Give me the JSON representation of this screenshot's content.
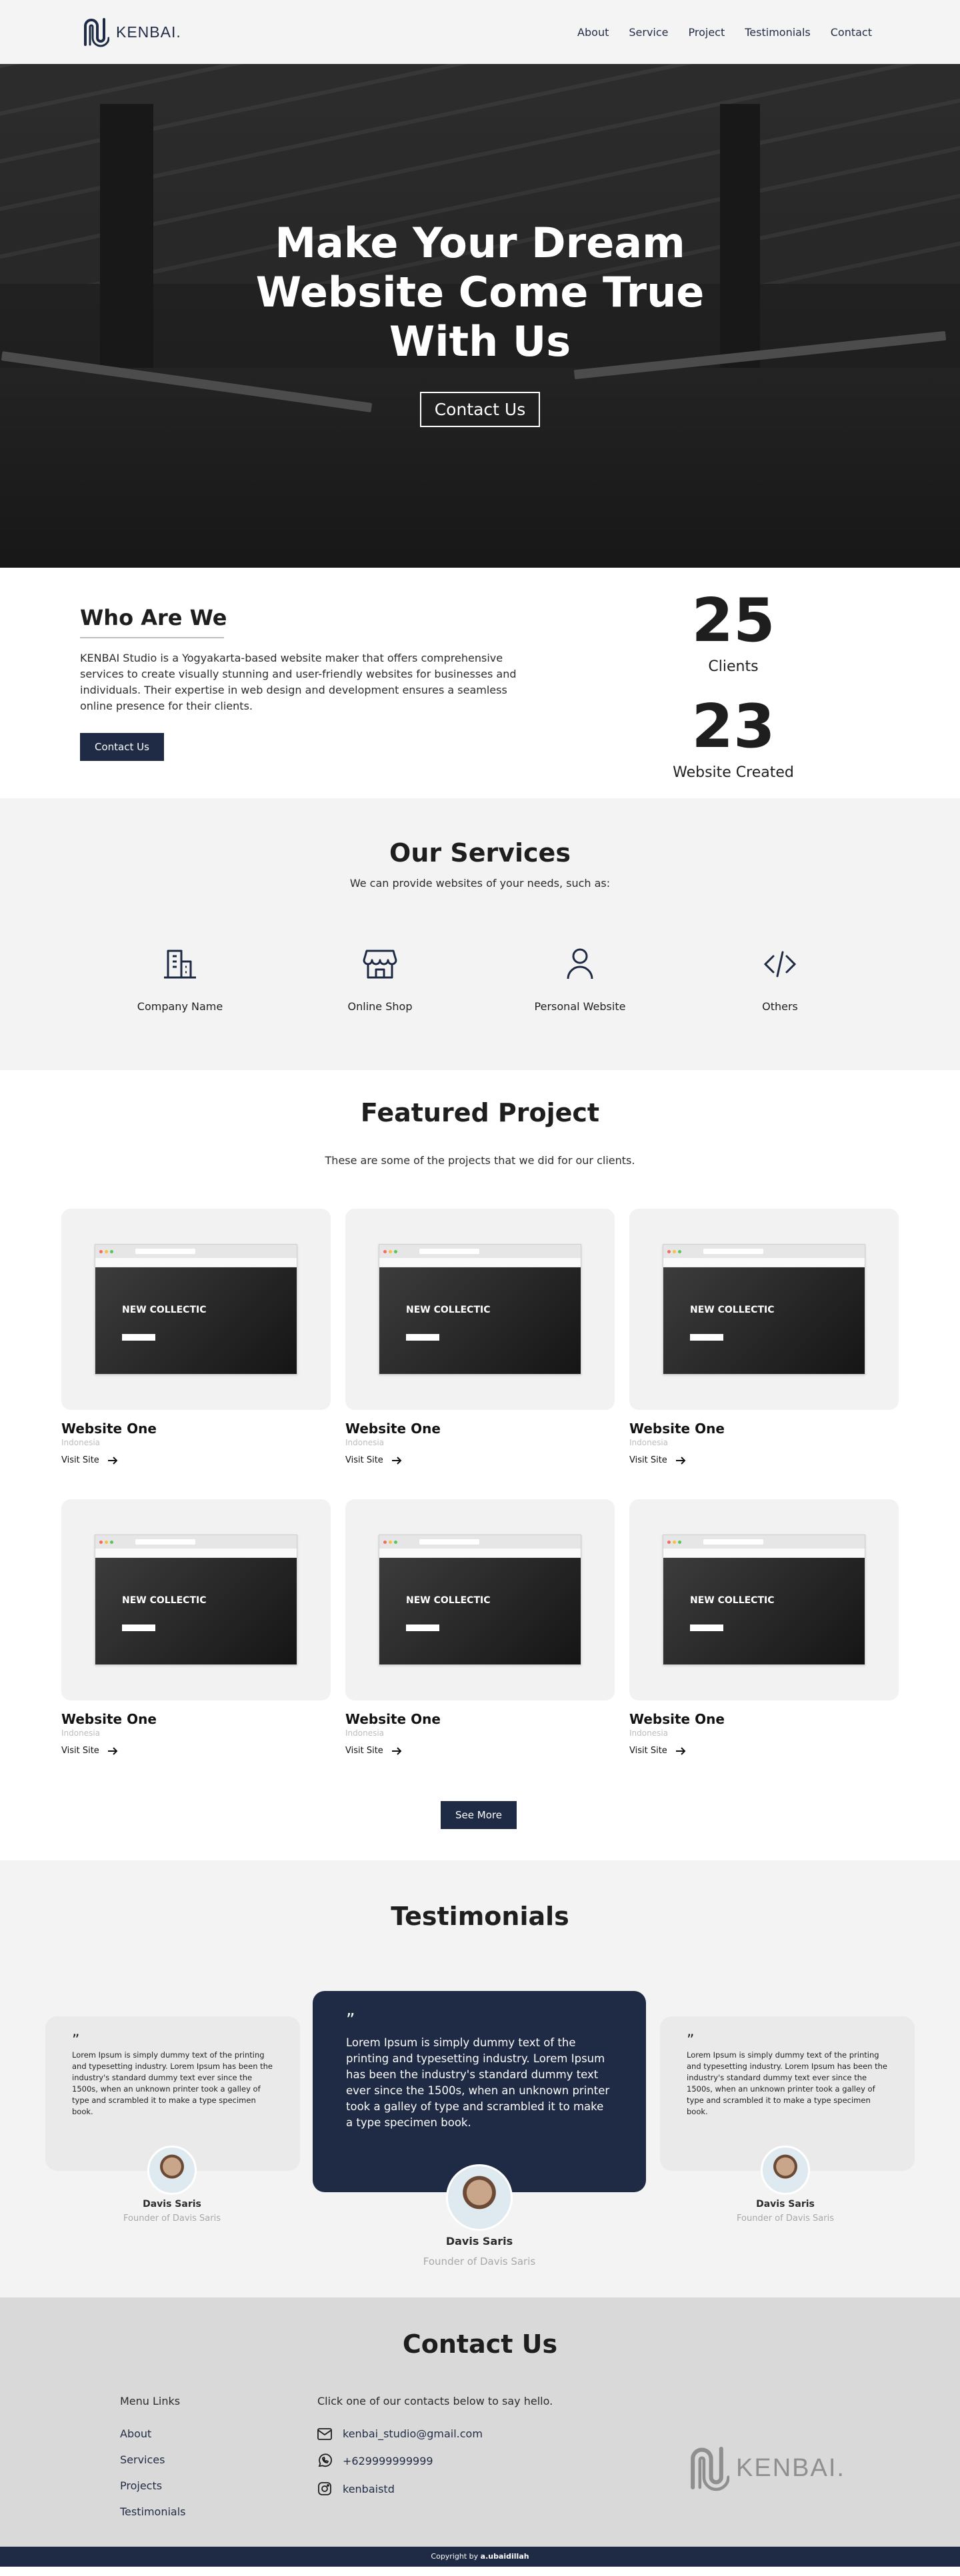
{
  "brand": {
    "name": "KENBAI."
  },
  "nav": {
    "links": [
      "About",
      "Service",
      "Project",
      "Testimonials",
      "Contact"
    ]
  },
  "hero": {
    "title": "Make Your Dream Website Come True With Us",
    "button": "Contact Us"
  },
  "about": {
    "title": "Who Are We",
    "text": "KENBAI Studio is a Yogyakarta-based website maker that offers comprehensive services to create visually stunning and user-friendly websites for businesses and individuals. Their expertise in web design and development ensures a seamless online presence for their clients.",
    "button": "Contact Us",
    "stats": [
      {
        "value": "25",
        "label": "Clients"
      },
      {
        "value": "23",
        "label": "Website Created"
      }
    ]
  },
  "services": {
    "title": "Our Services",
    "subtitle": "We can provide websites of your needs, such as:",
    "items": [
      {
        "label": "Company Name",
        "icon": "building-icon"
      },
      {
        "label": "Online Shop",
        "icon": "store-icon"
      },
      {
        "label": "Personal Website",
        "icon": "user-icon"
      },
      {
        "label": "Others",
        "icon": "code-icon"
      }
    ]
  },
  "projects": {
    "title": "Featured Project",
    "subtitle": "These are some of the projects that we did for our clients.",
    "mock_title": "NEW COLLECTIC",
    "items": [
      {
        "name": "Website One",
        "location": "Indonesia",
        "link": "Visit Site"
      },
      {
        "name": "Website One",
        "location": "Indonesia",
        "link": "Visit Site"
      },
      {
        "name": "Website One",
        "location": "Indonesia",
        "link": "Visit Site"
      },
      {
        "name": "Website One",
        "location": "Indonesia",
        "link": "Visit Site"
      },
      {
        "name": "Website One",
        "location": "Indonesia",
        "link": "Visit Site"
      },
      {
        "name": "Website One",
        "location": "Indonesia",
        "link": "Visit Site"
      }
    ],
    "see_more": "See More"
  },
  "testimonials": {
    "title": "Testimonials",
    "quote_mark": "”",
    "items": [
      {
        "text": "Lorem Ipsum is simply dummy text of the printing and typesetting industry. Lorem Ipsum has been the industry's standard dummy text ever since the 1500s, when an unknown printer took a galley of type and scrambled it to make a type specimen book.",
        "name": "Davis Saris",
        "role": "Founder of Davis Saris"
      },
      {
        "text": "Lorem Ipsum is simply dummy text of the printing and typesetting industry. Lorem Ipsum has been the industry's standard dummy text ever since the 1500s, when an unknown printer took a galley of type and scrambled it to make a type specimen book.",
        "name": "Davis Saris",
        "role": "Founder of Davis Saris"
      },
      {
        "text": "Lorem Ipsum is simply dummy text of the printing and typesetting industry. Lorem Ipsum has been the industry's standard dummy text ever since the 1500s, when an unknown printer took a galley of type and scrambled it to make a type specimen book.",
        "name": "Davis Saris",
        "role": "Founder of Davis Saris"
      }
    ]
  },
  "contact": {
    "title": "Contact Us",
    "menu_head": "Menu Links",
    "menu": [
      "About",
      "Services",
      "Projects",
      "Testimonials"
    ],
    "info_head": "Click one of our contacts below to say hello.",
    "email": "kenbai_studio@gmail.com",
    "phone": "+629999999999",
    "instagram": "kenbaistd"
  },
  "footer": {
    "prefix": "Copyright by ",
    "author": "a.ubaidillah"
  },
  "colors": {
    "navy": "#1f2a44",
    "light": "#f3f3f3",
    "contact_bg": "#d9d9d9"
  }
}
